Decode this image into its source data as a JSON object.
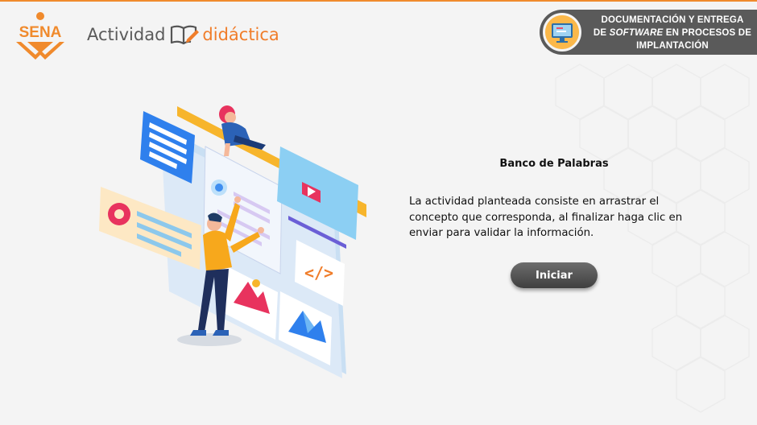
{
  "header": {
    "logo_text": "SENA",
    "brand_word1": "Actividad",
    "brand_word2": "didáctica",
    "badge_line1": "DOCUMENTACIÓN Y ENTREGA",
    "badge_line2_prefix": "DE ",
    "badge_line2_italic": "SOFTWARE",
    "badge_line2_suffix": " EN PROCESOS DE",
    "badge_line3": "IMPLANTACIÓN"
  },
  "main": {
    "title": "Banco de Palabras",
    "description": "La actividad planteada consiste en arrastrar el concepto que corresponda, al finalizar haga clic en enviar para validar la información.",
    "start_button": "Iniciar"
  },
  "colors": {
    "accent_orange": "#f07d2a",
    "sena_green_replaced_orange": "#f08a2c",
    "badge_gray": "#5a5a5a",
    "button_gray": "#505050"
  },
  "icons": [
    "sena-logo",
    "book-pencil-icon",
    "monitor-icon",
    "gear-icon",
    "play-icon",
    "code-icon",
    "image-icon"
  ]
}
